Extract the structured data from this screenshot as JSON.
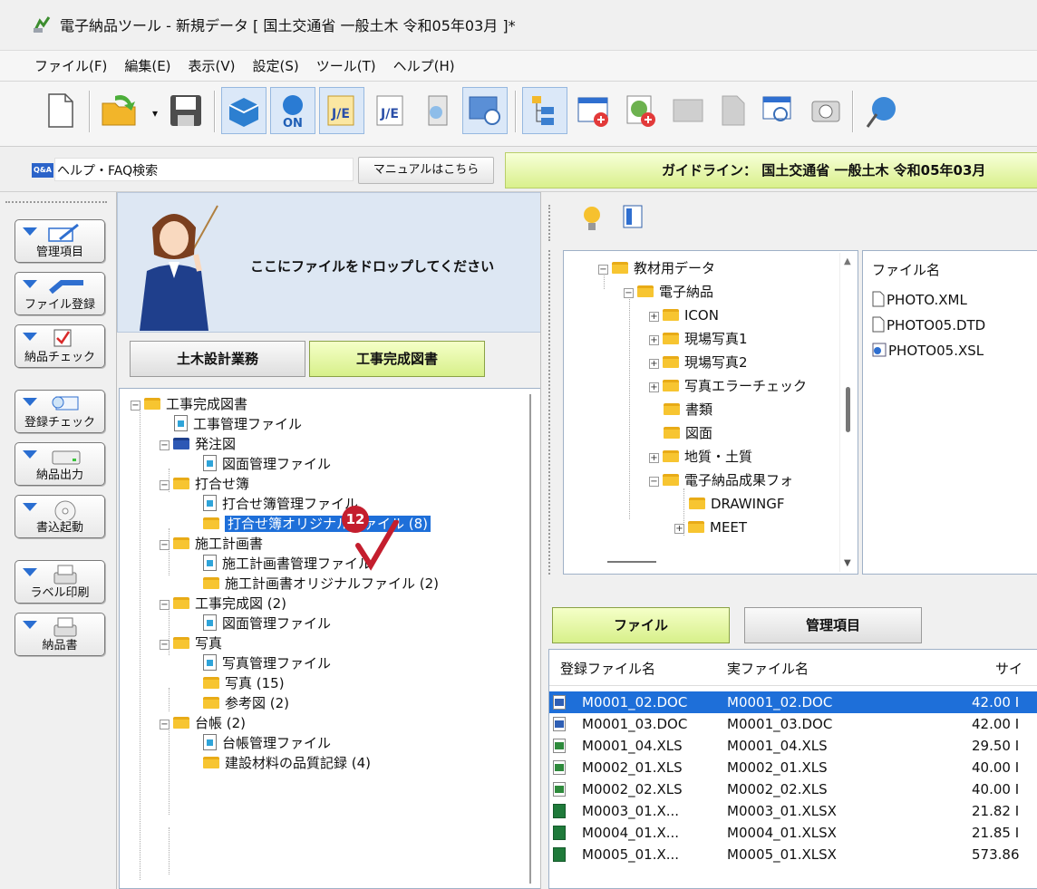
{
  "window": {
    "title": "電子納品ツール - 新規データ [ 国土交通省 一般土木 令和05年03月 ]*"
  },
  "menu": [
    "ファイル(F)",
    "編集(E)",
    "表示(V)",
    "設定(S)",
    "ツール(T)",
    "ヘルプ(H)"
  ],
  "helpbar": {
    "qa_label": "Q&A",
    "search_label": "ヘルプ・FAQ検索",
    "manual_button": "マニュアルはこちら",
    "guideline": "ガイドライン： 国土交通省 一般土木 令和05年03月"
  },
  "sidebar": [
    {
      "label": "管理項目",
      "icon": "edit-icon"
    },
    {
      "label": "ファイル登録",
      "icon": "file-register-icon"
    },
    {
      "label": "納品チェック",
      "icon": "check-icon"
    },
    {
      "label": "登録チェック",
      "icon": "register-check-icon"
    },
    {
      "label": "納品出力",
      "icon": "drive-icon"
    },
    {
      "label": "書込起動",
      "icon": "disc-icon"
    },
    {
      "label": "ラベル印刷",
      "icon": "printer-icon"
    },
    {
      "label": "納品書",
      "icon": "printer-icon"
    }
  ],
  "dropzone": {
    "message": "ここにファイルをドロップしてください"
  },
  "tabs_left": [
    "土木設計業務",
    "工事完成図書"
  ],
  "tree": [
    {
      "label": "工事完成図書",
      "type": "folder",
      "level": 0,
      "pm": "−"
    },
    {
      "label": "工事管理ファイル",
      "type": "doc",
      "level": 1
    },
    {
      "label": "発注図",
      "type": "bfolder",
      "level": 1,
      "pm": "−"
    },
    {
      "label": "図面管理ファイル",
      "type": "doc",
      "level": 2
    },
    {
      "label": "打合せ簿",
      "type": "folder",
      "level": 1,
      "pm": "−"
    },
    {
      "label": "打合せ簿管理ファイル",
      "type": "doc",
      "level": 2
    },
    {
      "label": "打合せ簿オリジナルファイル (8)",
      "type": "folder",
      "level": 2,
      "selected": true
    },
    {
      "label": "施工計画書",
      "type": "folder",
      "level": 1,
      "pm": "−"
    },
    {
      "label": "施工計画書管理ファイル",
      "type": "doc",
      "level": 2
    },
    {
      "label": "施工計画書オリジナルファイル (2)",
      "type": "folder",
      "level": 2
    },
    {
      "label": "工事完成図 (2)",
      "type": "folder",
      "level": 1,
      "pm": "−"
    },
    {
      "label": "図面管理ファイル",
      "type": "doc",
      "level": 2
    },
    {
      "label": "写真",
      "type": "folder",
      "level": 1,
      "pm": "−"
    },
    {
      "label": "写真管理ファイル",
      "type": "doc",
      "level": 2
    },
    {
      "label": "写真 (15)",
      "type": "folder",
      "level": 2
    },
    {
      "label": "参考図 (2)",
      "type": "folder",
      "level": 2
    },
    {
      "label": "台帳 (2)",
      "type": "folder",
      "level": 1,
      "pm": "−"
    },
    {
      "label": "台帳管理ファイル",
      "type": "doc",
      "level": 2
    },
    {
      "label": "建設材料の品質記録 (4)",
      "type": "folder",
      "level": 2
    }
  ],
  "callout": {
    "number": "12"
  },
  "folder_tree": [
    {
      "label": "教材用データ",
      "level": 0,
      "pm": "−"
    },
    {
      "label": "電子納品",
      "level": 1,
      "pm": "−"
    },
    {
      "label": "ICON",
      "level": 2,
      "pm": "+"
    },
    {
      "label": "現場写真1",
      "level": 2,
      "pm": "+"
    },
    {
      "label": "現場写真2",
      "level": 2,
      "pm": "+"
    },
    {
      "label": "写真エラーチェック",
      "level": 2,
      "pm": "+"
    },
    {
      "label": "書類",
      "level": 2,
      "pm": ""
    },
    {
      "label": "図面",
      "level": 2,
      "pm": ""
    },
    {
      "label": "地質・土質",
      "level": 2,
      "pm": "+"
    },
    {
      "label": "電子納品成果フォ",
      "level": 2,
      "pm": "−"
    },
    {
      "label": "DRAWINGF",
      "level": 3,
      "pm": ""
    },
    {
      "label": "MEET",
      "level": 3,
      "pm": "+"
    }
  ],
  "file_list": {
    "header": "ファイル名",
    "items": [
      "PHOTO.XML",
      "PHOTO05.DTD",
      "PHOTO05.XSL"
    ]
  },
  "tabs_right": [
    "ファイル",
    "管理項目"
  ],
  "grid": {
    "headers": [
      "登録ファイル名",
      "実ファイル名",
      "サイ"
    ],
    "rows": [
      {
        "icon": "w",
        "reg": "M0001_02.DOC",
        "real": "M0001_02.DOC",
        "size": "42.00 I",
        "selected": true
      },
      {
        "icon": "w",
        "reg": "M0001_03.DOC",
        "real": "M0001_03.DOC",
        "size": "42.00 I"
      },
      {
        "icon": "x",
        "reg": "M0001_04.XLS",
        "real": "M0001_04.XLS",
        "size": "29.50 I"
      },
      {
        "icon": "x",
        "reg": "M0002_01.XLS",
        "real": "M0002_01.XLS",
        "size": "40.00 I"
      },
      {
        "icon": "x",
        "reg": "M0002_02.XLS",
        "real": "M0002_02.XLS",
        "size": "40.00 I"
      },
      {
        "icon": "xx",
        "reg": "M0003_01.X...",
        "real": "M0003_01.XLSX",
        "size": "21.82 I"
      },
      {
        "icon": "xx",
        "reg": "M0004_01.X...",
        "real": "M0004_01.XLSX",
        "size": "21.85 I"
      },
      {
        "icon": "xx",
        "reg": "M0005_01.X...",
        "real": "M0005_01.XLSX",
        "size": "573.86"
      }
    ]
  }
}
